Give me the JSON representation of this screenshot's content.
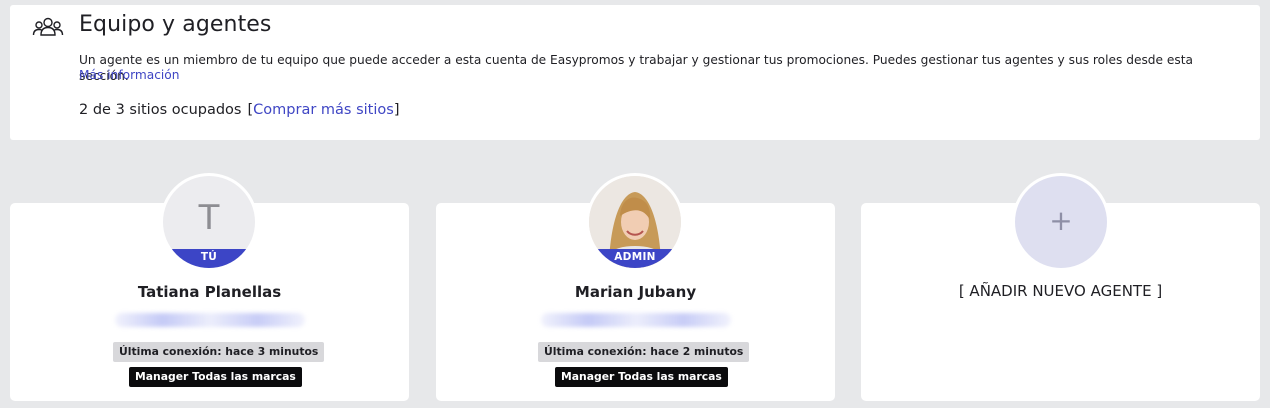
{
  "header": {
    "title": "Equipo y agentes",
    "icon": "team-icon",
    "description": "Un agente es un miembro de tu equipo que puede acceder a esta cuenta de Easypromos y trabajar y gestionar tus promociones. Puedes gestionar tus agentes y sus roles desde esta sección.",
    "more_link": "Más información",
    "seats_text": "2 de 3 sitios ocupados",
    "bracket_open": "[",
    "buy_link": "Comprar más sitios",
    "bracket_close": "]"
  },
  "agents": [
    {
      "avatar_letter": "T",
      "role_ribbon": "TÚ",
      "name": "Tatiana Planellas",
      "last_login": "Última conexión: hace 3 minutos",
      "role": "Manager Todas las marcas"
    },
    {
      "avatar_letter": "",
      "role_ribbon": "ADMIN",
      "name": "Marian Jubany",
      "last_login": "Última conexión: hace 2 minutos",
      "role": "Manager Todas las marcas"
    }
  ],
  "add_agent": {
    "icon": "+",
    "label": "[ AÑADIR NUEVO AGENTE ]"
  },
  "colors": {
    "accent": "#3c45c6",
    "link": "#3f46c4",
    "background": "#e7e8ea"
  }
}
